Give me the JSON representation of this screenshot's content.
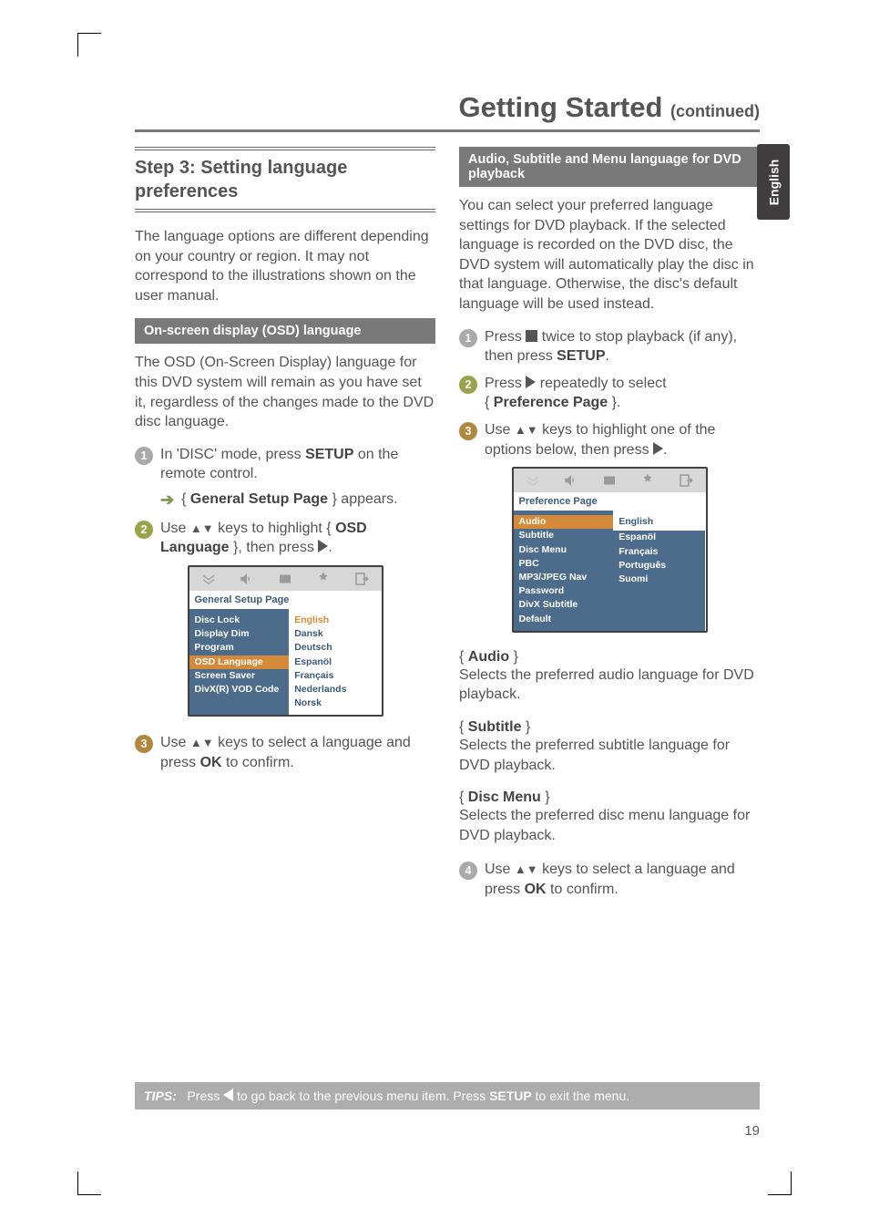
{
  "langTab": "English",
  "title": {
    "main": "Getting Started",
    "cont": "(continued)"
  },
  "left": {
    "stepHeading": "Step 3:  Setting language preferences",
    "intro": "The language options are different depending on your country or region.  It may not correspond to the illustrations shown on the user manual.",
    "subHead": "On-screen display (OSD) language",
    "osdPara": "The OSD (On-Screen Display) language for this DVD system will remain as you have set it, regardless of the changes made to the DVD disc language.",
    "s1a": "In 'DISC' mode, press ",
    "s1b": "SETUP",
    "s1c": " on the remote control.",
    "s1arrow1": "{ ",
    "s1arrow2": "General Setup Page",
    "s1arrow3": " } appears.",
    "s2a": "Use ",
    "s2keys": "▲▼",
    "s2b": " keys to highlight { ",
    "s2c": "OSD Language",
    "s2d": " }, then press ",
    "s3a": "Use ",
    "s3b": " keys to select a language and press ",
    "s3c": "OK",
    "s3d": " to confirm.",
    "menu": {
      "title": "General Setup Page",
      "left": [
        "Disc Lock",
        "Display Dim",
        "Program",
        "OSD Language",
        "Screen Saver",
        "DivX(R) VOD Code"
      ],
      "right": [
        "English",
        "Dansk",
        "Deutsch",
        "Espanöl",
        "Français",
        "Nederlands",
        "Norsk"
      ]
    }
  },
  "right": {
    "subHead": "Audio, Subtitle and Menu language for DVD playback",
    "intro": "You can select your preferred language settings for DVD playback.  If the selected language is recorded on the DVD disc, the DVD system will automatically play the disc in that language.  Otherwise, the disc's default language will be used instead.",
    "s1a": "Press  ",
    "s1b": "  twice to stop playback (if any), then press ",
    "s1c": "SETUP",
    "s1d": ".",
    "s2a": "Press ",
    "s2b": " repeatedly to select",
    "s2c": "{ ",
    "s2d": "Preference Page",
    "s2e": " }.",
    "s3a": "Use ",
    "s3b": " keys to highlight one of the options below, then press ",
    "menu": {
      "title": "Preference Page",
      "left": [
        "Audio",
        "Subtitle",
        "Disc Menu",
        "PBC",
        "MP3/JPEG Nav",
        "Password",
        "DivX Subtitle",
        "Default"
      ],
      "right": [
        "English",
        "Espanöl",
        "Français",
        "Português",
        "Suomi"
      ]
    },
    "defs": {
      "audioT": "Audio",
      "audioD": "Selects the preferred audio language for DVD playback.",
      "subT": "Subtitle",
      "subD": "Selects the preferred subtitle language for DVD playback.",
      "discT": "Disc Menu",
      "discD": "Selects the preferred disc menu language for DVD playback."
    },
    "s4a": "Use ",
    "s4b": " keys to select a language and press ",
    "s4c": "OK",
    "s4d": " to confirm."
  },
  "tips": {
    "label": "TIPS:",
    "t1": "Press ",
    "t2": " to go back to the previous menu item.  Press ",
    "t3": "SETUP",
    "t4": " to exit the menu."
  },
  "pageNumber": "19"
}
